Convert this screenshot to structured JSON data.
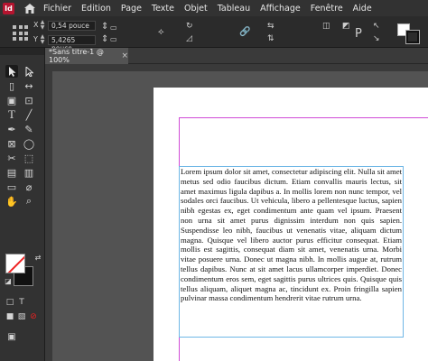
{
  "menubar": {
    "app_logo": "Id",
    "items": [
      "Fichier",
      "Edition",
      "Page",
      "Texte",
      "Objet",
      "Tableau",
      "Affichage",
      "Fenêtre",
      "Aide"
    ]
  },
  "controlbar": {
    "x_label": "X",
    "y_label": "Y",
    "x_value": "0,54 pouce",
    "y_value": "5,4265 pouce"
  },
  "tabs": [
    {
      "label": "*Sans titre-1 @ 100%"
    }
  ],
  "document": {
    "body_text": "Lorem ipsum dolor sit amet, consectetur adipiscing elit. Nulla sit amet metus sed odio faucibus dictum. Etiam convallis mauris lectus, sit amet maximus ligula dapibus a. In mollis lorem non nunc tempor, vel sodales orci faucibus. Ut vehicula, libero a pellentesque luctus, sapien nibh egestas ex, eget condimentum ante quam vel ipsum. Praesent non urna sit amet purus dignissim interdum non quis sapien. Suspendisse leo nibh, faucibus ut venenatis vitae, aliquam dictum magna. Quisque vel libero auctor purus efficitur consequat. Etiam mollis est sagittis, consequat diam sit amet, venenatis urna. Morbi vitae posuere urna. Donec ut magna nibh. In mollis augue at, rutrum tellus dapibus. Nunc at sit amet lacus ullamcorper imperdiet. Donec condimentum eros sem, eget sagittis purus ultrices quis. Quisque quis tellus aliquam, aliquet magna ac, tincidunt ex. Proin fringilla sapien pulvinar massa condimentum hendrerit vitae rutrum urna."
  },
  "colors": {
    "accent": "#b5142f",
    "margin_guide": "#d04bd6",
    "frame_border": "#6fb7e6"
  }
}
